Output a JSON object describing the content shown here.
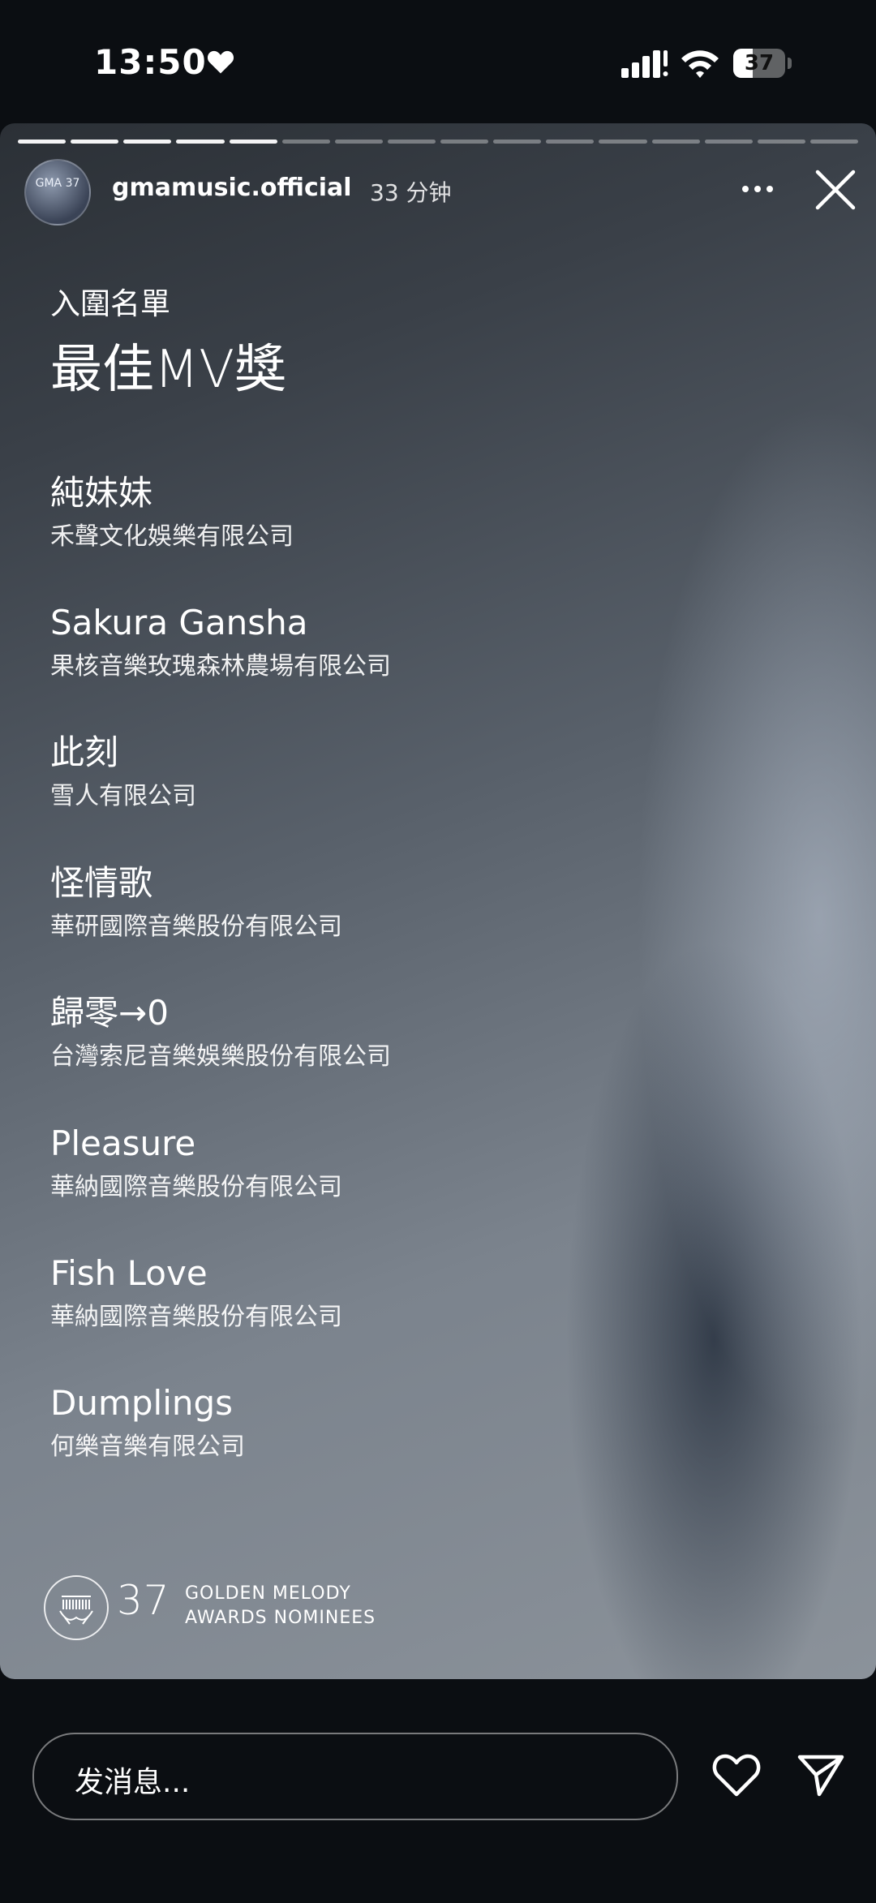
{
  "status_bar": {
    "time": "13:50",
    "battery_level": "37",
    "battery_fraction": 0.37
  },
  "story": {
    "progress": {
      "segments_total": 16,
      "segments_viewed": 5
    },
    "username": "gmamusic.official",
    "time_ago": "33 分钟",
    "avatar_text": "GMA 37",
    "caption_label": "入圍名單",
    "caption_title": "最佳MV獎",
    "nominees": [
      {
        "title": "純妹妹",
        "company": "禾聲文化娛樂有限公司"
      },
      {
        "title": "Sakura Gansha",
        "company": "果核音樂玫瑰森林農場有限公司"
      },
      {
        "title": "此刻",
        "company": "雪人有限公司"
      },
      {
        "title": "怪情歌",
        "company": "華研國際音樂股份有限公司"
      },
      {
        "title": "歸零→0",
        "company": "台灣索尼音樂娛樂股份有限公司"
      },
      {
        "title": "Pleasure",
        "company": "華納國際音樂股份有限公司"
      },
      {
        "title": "Fish Love",
        "company": "華納國際音樂股份有限公司"
      },
      {
        "title": "Dumplings",
        "company": "何樂音樂有限公司"
      }
    ],
    "footer": {
      "number": "37",
      "line1": "GOLDEN MELODY",
      "line2": "AWARDS NOMINEES"
    }
  },
  "bottom_bar": {
    "message_placeholder": "发消息..."
  },
  "icons": {
    "status_heart": "heart-icon",
    "signal": "cellular-signal-icon",
    "wifi": "wifi-icon",
    "battery": "battery-icon",
    "more": "more-options-icon",
    "close": "close-icon",
    "like": "heart-outline-icon",
    "send": "send-icon",
    "logo": "gma-logo-icon"
  }
}
